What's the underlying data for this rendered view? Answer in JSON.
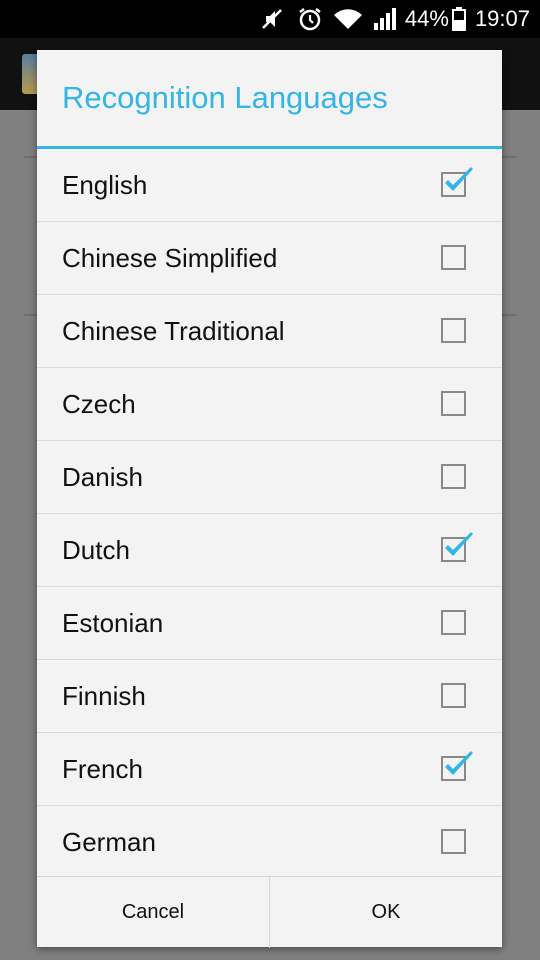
{
  "status_bar": {
    "icons": [
      "mute-icon",
      "alarm-icon",
      "wifi-icon",
      "signal-icon",
      "battery-icon"
    ],
    "battery_percent": "44%",
    "time": "19:07"
  },
  "dialog": {
    "title": "Recognition Languages",
    "accent_color": "#33b5e5",
    "languages": [
      {
        "label": "English",
        "checked": true
      },
      {
        "label": "Chinese Simplified",
        "checked": false
      },
      {
        "label": "Chinese Traditional",
        "checked": false
      },
      {
        "label": "Czech",
        "checked": false
      },
      {
        "label": "Danish",
        "checked": false
      },
      {
        "label": "Dutch",
        "checked": true
      },
      {
        "label": "Estonian",
        "checked": false
      },
      {
        "label": "Finnish",
        "checked": false
      },
      {
        "label": "French",
        "checked": true
      },
      {
        "label": "German",
        "checked": false
      }
    ],
    "cancel_label": "Cancel",
    "ok_label": "OK"
  }
}
